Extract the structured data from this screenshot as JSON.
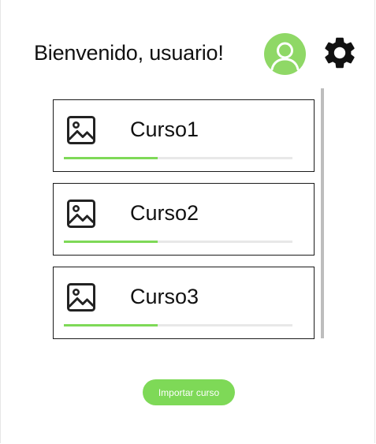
{
  "header": {
    "greeting": "Bienvenido, usuario!",
    "avatar_icon": "user-avatar-icon",
    "settings_icon": "gear-icon"
  },
  "courses": [
    {
      "title": "Curso1",
      "icon": "image-icon",
      "progress": 0.41
    },
    {
      "title": "Curso2",
      "icon": "image-icon",
      "progress": 0.41
    },
    {
      "title": "Curso3",
      "icon": "image-icon",
      "progress": 0.41
    }
  ],
  "actions": {
    "import_label": "Importar curso"
  },
  "colors": {
    "accent": "#7ed957",
    "avatar_bg": "#8fd866",
    "scrollbar": "#bdbdbd",
    "progress_track": "#e8e8e8"
  }
}
